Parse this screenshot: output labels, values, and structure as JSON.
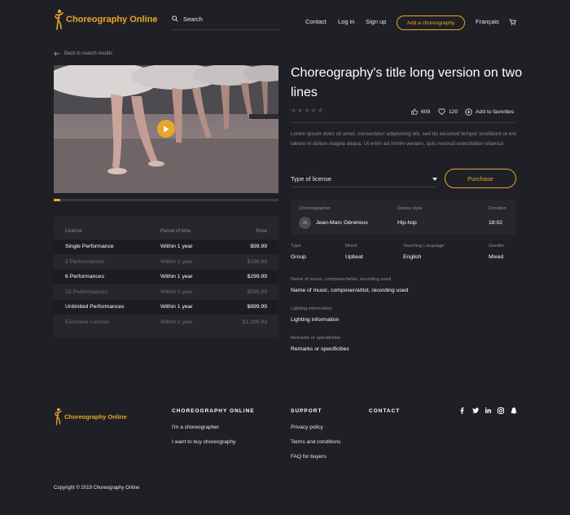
{
  "header": {
    "logo_text": "Choreography Online",
    "search_placeholder": "Search",
    "nav": {
      "contact": "Contact",
      "login": "Log in",
      "signup": "Sign up"
    },
    "add_choreography": "Add a choreography",
    "language": "Français"
  },
  "back_link": "Back to search results",
  "video": {
    "progress_fraction": 0.03
  },
  "price_table": {
    "headers": {
      "license": "License",
      "period": "Period of time",
      "price": "Price"
    },
    "rows": [
      {
        "license": "Single Performance",
        "period": "Within 1 year",
        "price": "$99.99",
        "active": true
      },
      {
        "license": "3 Performances",
        "period": "Within 1 year",
        "price": "$199.99",
        "active": false
      },
      {
        "license": "6 Performances",
        "period": "Within 1 year",
        "price": "$299.99",
        "active": true
      },
      {
        "license": "15 Performances",
        "period": "Within 1 year",
        "price": "$599.99",
        "active": false
      },
      {
        "license": "Unlimited Performances",
        "period": "Within 1 year",
        "price": "$899.99",
        "active": true
      },
      {
        "license": "Exclusive License",
        "period": "Within 1 year",
        "price": "$1,199.99",
        "active": false
      }
    ]
  },
  "detail": {
    "title": "Choreography's title long version on two lines",
    "likes": "609",
    "favorites_count": "120",
    "add_favorites": "Add to favorites",
    "description": "Lorem ipsum dolor sit amet, consectetur adipisicing elit, sed do eiusmod tempor incididunt ut ero labore et dolore magna aliqua. Ut enim ad minim veniam, quis nostrud exercitation ullamco",
    "license_select": "Type of license",
    "purchase": "Purchase",
    "choreographer_label": "Choreographer",
    "choreographer_initials": "JG",
    "choreographer_name": "Jean-Marc Généreux",
    "style_label": "Dance style",
    "style": "Hip-hop",
    "duration_label": "Duration",
    "duration": "18:02",
    "type_label": "Type",
    "type": "Group",
    "mood_label": "Mood",
    "mood": "Upbeat",
    "teaching_label": "Teaching Language",
    "teaching": "English",
    "gender_label": "Gender",
    "gender": "Mixed",
    "music_label": "Name of music, composer/artist, recording used",
    "music": "Name of music, composer/artist, recording used",
    "lighting_label": "Lighting information",
    "lighting": "Lighting information",
    "remarks_label": "Remarks or specificities",
    "remarks": "Remarks or specificities"
  },
  "footer": {
    "logo_text": "Choreography Online",
    "col1_title": "CHOREOGRAPHY ONLINE",
    "col1_links": [
      "I'm a choreographer",
      "I want to buy choreography"
    ],
    "col2_title": "SUPPORT",
    "col2_links": [
      "Privacy policy",
      "Terms and conditions",
      "FAQ for buyers"
    ],
    "col3_title": "CONTACT",
    "copyright": "Copyright © 2019 Choreography Online"
  },
  "colors": {
    "accent": "#e8a529",
    "background": "#1f2025",
    "panel": "#26272c"
  }
}
